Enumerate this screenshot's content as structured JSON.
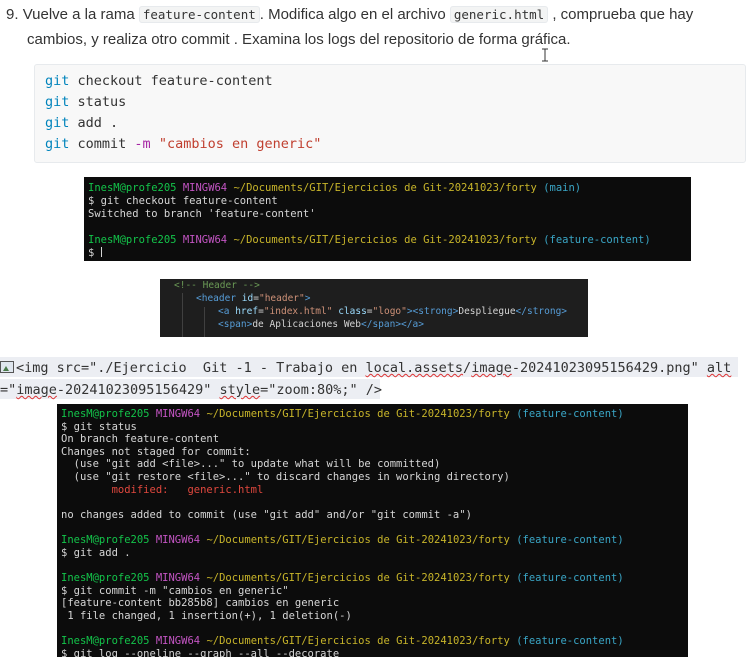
{
  "instruction": {
    "number": "9.",
    "part1": "Vuelve a la rama ",
    "code1": "feature-content",
    "part2": ". Modifica algo en el archivo ",
    "code2": "generic.html",
    "part3": " , comprueba que hay",
    "line2": "cambios, y realiza otro commit . Examina los logs del repositorio de forma gráfica."
  },
  "code_block": {
    "lines": [
      {
        "cmd": "git",
        "rest": " checkout feature-content",
        "opt": "",
        "str": ""
      },
      {
        "cmd": "git",
        "rest": " status",
        "opt": "",
        "str": ""
      },
      {
        "cmd": "git",
        "rest": " add .",
        "opt": "",
        "str": ""
      },
      {
        "cmd": "git",
        "rest": " commit ",
        "opt": "-m",
        "str": " \"cambios en generic\""
      }
    ]
  },
  "terminal1": {
    "prompt_user": "InesM@profe205",
    "prompt_sys": "MINGW64",
    "prompt_path": "~/Documents/GIT/Ejercicios de Git-20241023/forty",
    "branch_main": "(main)",
    "cmd1": "$ git checkout feature-content",
    "out1": "Switched to branch 'feature-content'",
    "branch_fc": "(feature-content)",
    "prompt_end": "$ "
  },
  "editor": {
    "line1": "<!-- Header -->",
    "l2_tag_open": "<header",
    "l2_attr": "id",
    "l2_val": "\"header\"",
    "l2_close": ">",
    "l3_tag": "<a",
    "l3_attr1": "href",
    "l3_val1": "\"index.html\"",
    "l3_attr2": "class",
    "l3_val2": "\"logo\"",
    "l3_mid": "><strong>",
    "l3_text": "Despliegue",
    "l3_end": "</strong>",
    "l4_tag": "<span>",
    "l4_text": "de Aplicaciones Web",
    "l4_end": "</span></a>"
  },
  "broken_image": {
    "l1_a": "<img src=\"./Ejercicio  Git -1 - Trabajo en ",
    "l1_b": "local.assets",
    "l1_c": "/",
    "l1_d": "image",
    "l1_e": "-20241023095156429.png\" ",
    "l1_f": "alt",
    "l2_a": "=\"",
    "l2_b": "image",
    "l2_c": "-20241023095156429\" ",
    "l2_d": "style",
    "l2_e": "=\"zoom:80%;\" />"
  },
  "terminal2": {
    "prompt_user": "InesM@profe205",
    "prompt_sys": "MINGW64",
    "prompt_path": "~/Documents/GIT/Ejercicios de Git-20241023/forty",
    "branch": "(feature-content)",
    "cmd_status": "$ git status",
    "s1": "On branch feature-content",
    "s2": "Changes not staged for commit:",
    "s3": "  (use \"git add <file>...\" to update what will be committed)",
    "s4": "  (use \"git restore <file>...\" to discard changes in working directory)",
    "s5_label": "        modified:   ",
    "s5_file": "generic.html",
    "s6": "no changes added to commit (use \"git add\" and/or \"git commit -a\")",
    "cmd_add": "$ git add .",
    "cmd_commit": "$ git commit -m \"cambios en generic\"",
    "c1": "[feature-content bb285b8] cambios en generic",
    "c2": " 1 file changed, 1 insertion(+), 1 deletion(-)",
    "cmd_log": "$ git log --oneline --graph --all --decorate"
  }
}
